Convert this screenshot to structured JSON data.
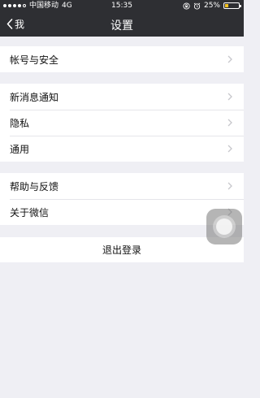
{
  "status_bar": {
    "signal_dots_filled": 4,
    "signal_dots_total": 5,
    "carrier": "中国移动",
    "network": "4G",
    "time": "15:35",
    "battery_percent": "25%",
    "battery_level": 0.25,
    "battery_color": "#f7c31e"
  },
  "nav": {
    "back_label": "我",
    "title": "设置"
  },
  "groups": [
    {
      "items": [
        {
          "label": "帐号与安全"
        }
      ]
    },
    {
      "items": [
        {
          "label": "新消息通知"
        },
        {
          "label": "隐私"
        },
        {
          "label": "通用"
        }
      ]
    },
    {
      "items": [
        {
          "label": "帮助与反馈"
        },
        {
          "label": "关于微信"
        }
      ]
    }
  ],
  "logout_label": "退出登录",
  "icons": {
    "back": "chevron-left-icon",
    "row_arrow": "chevron-right-icon",
    "alarm": "alarm-icon",
    "lock": "rotation-lock-icon",
    "assistive_touch": "assistive-touch-icon"
  }
}
